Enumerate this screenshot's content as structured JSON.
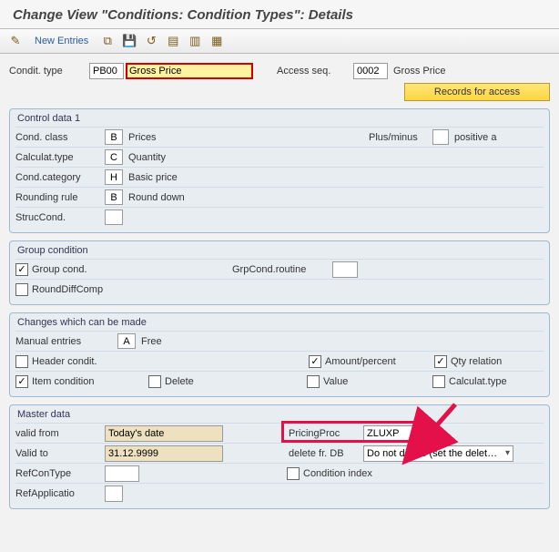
{
  "title": "Change View \"Conditions: Condition Types\": Details",
  "toolbar": {
    "new_entries": "New Entries"
  },
  "header": {
    "condit_type_label": "Condit. type",
    "condit_type_code": "PB00",
    "condit_type_text": "Gross Price",
    "access_seq_label": "Access seq.",
    "access_seq_code": "0002",
    "access_seq_text": "Gross Price",
    "records_btn": "Records for access"
  },
  "control": {
    "title": "Control data 1",
    "cond_class_label": "Cond. class",
    "cond_class_code": "B",
    "cond_class_text": "Prices",
    "calc_type_label": "Calculat.type",
    "calc_type_code": "C",
    "calc_type_text": "Quantity",
    "cond_cat_label": "Cond.category",
    "cond_cat_code": "H",
    "cond_cat_text": "Basic price",
    "round_label": "Rounding rule",
    "round_code": "B",
    "round_text": "Round down",
    "struc_label": "StrucCond.",
    "plusminus_label": "Plus/minus",
    "plusminus_text": "positive a"
  },
  "group": {
    "title": "Group condition",
    "group_cond": "Group cond.",
    "round_diff": "RoundDiffComp",
    "grp_routine": "GrpCond.routine"
  },
  "changes": {
    "title": "Changes which can be made",
    "manual_label": "Manual entries",
    "manual_code": "A",
    "manual_text": "Free",
    "header_cond": "Header condit.",
    "item_cond": "Item condition",
    "delete": "Delete",
    "amount": "Amount/percent",
    "value": "Value",
    "qty": "Qty relation",
    "calc": "Calculat.type"
  },
  "master": {
    "title": "Master data",
    "valid_from_label": "valid from",
    "valid_from_val": "Today's date",
    "valid_to_label": "Valid to",
    "valid_to_val": "31.12.9999",
    "refcontype_label": "RefConType",
    "refapp_label": "RefApplicatio",
    "pricing_label": "PricingProc",
    "pricing_val": "ZLUXP",
    "delete_db_label": "delete fr. DB",
    "delete_db_val": "Do not delete (set the delet…",
    "cond_index": "Condition index"
  }
}
